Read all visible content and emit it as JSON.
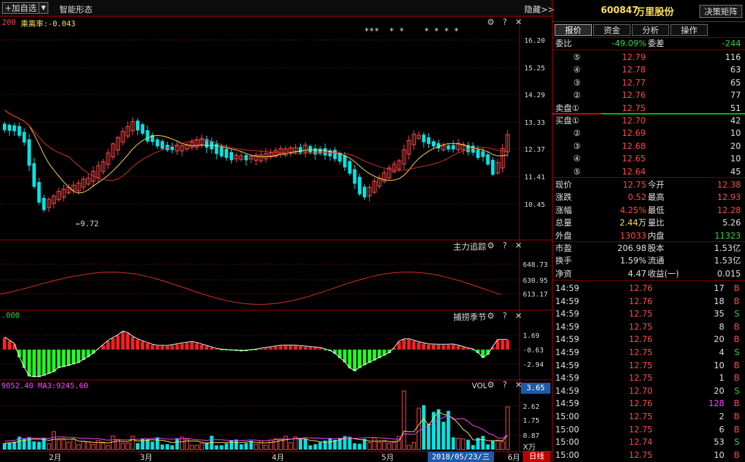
{
  "toolbar": {
    "add_watchlist": "+加自选",
    "dropdown_glyph": "▼",
    "smart_pattern": "智能形态",
    "hide": "隐藏>>"
  },
  "main_panel": {
    "indicator_period": "200",
    "indicator_label": "乘离率:-0.043",
    "stars": "***  * *    * * * *",
    "y_ticks": [
      "16.20",
      "15.25",
      "14.29",
      "13.33",
      "12.37",
      "11.41",
      "10.45"
    ],
    "low_marker": "←9.72"
  },
  "panel2": {
    "title": "主力追踪",
    "y_ticks": [
      "648.73",
      "630.95",
      "613.17"
    ]
  },
  "panel3": {
    "title": "捕捞季节",
    "left_label": ".000",
    "y_ticks": [
      "1.69",
      "-0.63",
      "-2.94"
    ]
  },
  "panel4": {
    "title": "VOL",
    "left_label": "9052.40  MA3:9245.60",
    "y_ticks": [
      "3.65",
      "2.62",
      "1.75",
      "0.87"
    ],
    "unit": "X万",
    "months": [
      "2月",
      "3月",
      "4月",
      "5月",
      "6月"
    ],
    "date_box": "2018/05/23/三",
    "daily_button": "日线"
  },
  "panel_controls": "⚙ ? ✕",
  "stock": {
    "code": "600847",
    "name": "万里股份",
    "matrix_button": "决策矩阵"
  },
  "tabs": [
    "报价",
    "资金",
    "分析",
    "操作"
  ],
  "ratio": {
    "label": "委比",
    "value": "-49.09%",
    "label2": "委差",
    "value2": "-244"
  },
  "asks": [
    {
      "level": "⑤",
      "price": "12.79",
      "vol": "116"
    },
    {
      "level": "④",
      "price": "12.78",
      "vol": "63"
    },
    {
      "level": "③",
      "price": "12.77",
      "vol": "65"
    },
    {
      "level": "②",
      "price": "12.76",
      "vol": "77"
    },
    {
      "level": "卖盘①",
      "price": "12.75",
      "vol": "51"
    }
  ],
  "bids": [
    {
      "level": "买盘①",
      "price": "12.70",
      "vol": "42"
    },
    {
      "level": "②",
      "price": "12.69",
      "vol": "10"
    },
    {
      "level": "③",
      "price": "12.68",
      "vol": "20"
    },
    {
      "level": "④",
      "price": "12.65",
      "vol": "10"
    },
    {
      "level": "⑤",
      "price": "12.64",
      "vol": "45"
    }
  ],
  "quote": {
    "now_l": "现价",
    "now_v": "12.75",
    "open_l": "今开",
    "open_v": "12.38",
    "chg_l": "涨跌",
    "chg_v": "0.52",
    "high_l": "最高",
    "high_v": "12.93",
    "pct_l": "涨幅",
    "pct_v": "4.25%",
    "low_l": "最低",
    "low_v": "12.28",
    "vol_l": "总量",
    "vol_v": "2.44",
    "vol_u": "万",
    "vr_l": "量比",
    "vr_v": "5.26",
    "out_l": "外盘",
    "out_v": "13033",
    "in_l": "内盘",
    "in_v": "11323"
  },
  "fund": {
    "mcap_l": "市盈",
    "mcap_v": "206.98",
    "cap_l": "股本",
    "cap_v": "1.53亿",
    "turn_l": "换手",
    "turn_v": "1.59%",
    "flt_l": "流通",
    "flt_v": "1.53亿",
    "na_l": "净资",
    "na_v": "4.47",
    "eps_l": "收益(一)",
    "eps_v": "0.015"
  },
  "ticks": [
    {
      "t": "14:59",
      "p": "12.76",
      "v": "17",
      "s": "B"
    },
    {
      "t": "14:59",
      "p": "12.76",
      "v": "18",
      "s": "B"
    },
    {
      "t": "14:59",
      "p": "12.75",
      "v": "35",
      "s": "S"
    },
    {
      "t": "14:59",
      "p": "12.75",
      "v": "8",
      "s": "B"
    },
    {
      "t": "14:59",
      "p": "12.76",
      "v": "20",
      "s": "B"
    },
    {
      "t": "14:59",
      "p": "12.75",
      "v": "4",
      "s": "S"
    },
    {
      "t": "14:59",
      "p": "12.75",
      "v": "10",
      "s": "B"
    },
    {
      "t": "14:59",
      "p": "12.75",
      "v": "1",
      "s": "B"
    },
    {
      "t": "14:59",
      "p": "12.70",
      "v": "20",
      "s": "S"
    },
    {
      "t": "14:59",
      "p": "12.76",
      "v": "128",
      "s": "B"
    },
    {
      "t": "15:00",
      "p": "12.75",
      "v": "2",
      "s": "B"
    },
    {
      "t": "15:00",
      "p": "12.75",
      "v": "6",
      "s": "B"
    },
    {
      "t": "15:00",
      "p": "12.74",
      "v": "53",
      "s": "S"
    },
    {
      "t": "15:00",
      "p": "12.75",
      "v": "10",
      "s": "B"
    }
  ],
  "colors": {
    "up": "#ff4a4a",
    "down": "#00e5e5",
    "green": "#32d232",
    "grid": "#a00000",
    "ma_yellow": "#ffe14d",
    "magenta": "#ff44ff"
  }
}
